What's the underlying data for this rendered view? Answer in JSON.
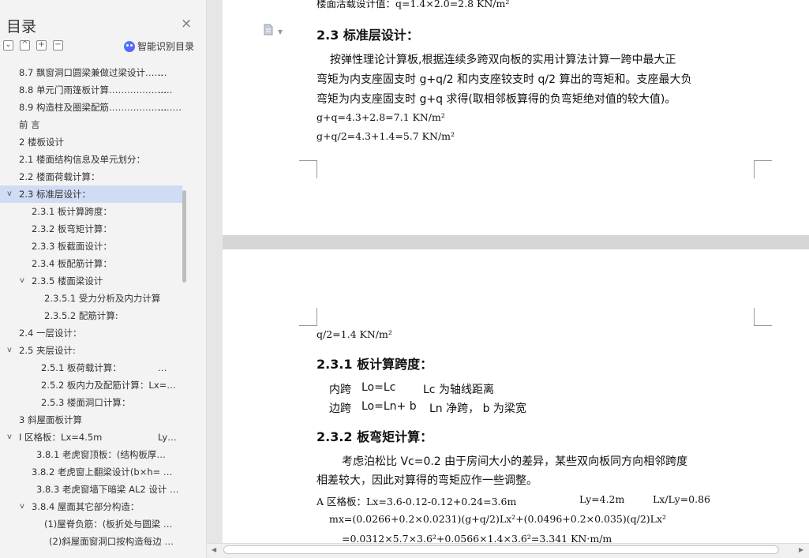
{
  "sidebar": {
    "title": "目录",
    "close_glyph": "×",
    "tools": [
      "⌄",
      "^",
      "+",
      "−"
    ],
    "ai_label": "智能识别目录",
    "items": [
      {
        "label": "8.7 飘窗洞口圆梁兼做过梁设计……",
        "suffix": "…",
        "level": 1,
        "toggle": ""
      },
      {
        "label": "8.8 单元门雨篷板计算…………………",
        "suffix": "…",
        "level": 1,
        "toggle": ""
      },
      {
        "label": "8.9 构造柱及圈梁配筋……………………",
        "suffix": "…",
        "level": 1,
        "toggle": ""
      },
      {
        "label": "前    言",
        "suffix": "",
        "level": 1,
        "toggle": ""
      },
      {
        "label": "2 楼板设计",
        "suffix": "",
        "level": 1,
        "toggle": ""
      },
      {
        "label": "2.1 楼面结构信息及单元划分：",
        "suffix": "",
        "level": 1,
        "toggle": ""
      },
      {
        "label": "2.2 楼面荷载计算：",
        "suffix": "",
        "level": 1,
        "toggle": ""
      },
      {
        "label": "2.3 标准层设计：",
        "suffix": "",
        "level": 1,
        "toggle": "v",
        "selected": true
      },
      {
        "label": "2.3.1 板计算跨度：",
        "suffix": "",
        "level": 2,
        "toggle": ""
      },
      {
        "label": "2.3.2 板弯矩计算：",
        "suffix": "",
        "level": 2,
        "toggle": ""
      },
      {
        "label": "2.3.3 板截面设计：",
        "suffix": "",
        "level": 2,
        "toggle": ""
      },
      {
        "label": "2.3.4 板配筋计算：",
        "suffix": "",
        "level": 2,
        "toggle": ""
      },
      {
        "label": "2.3.5 楼面梁设计",
        "suffix": "",
        "level": 2,
        "toggle": "v"
      },
      {
        "label": "2.3.5.1 受力分析及内力计算",
        "suffix": "",
        "level": 3,
        "toggle": ""
      },
      {
        "label": "2.3.5.2 配筋计算:",
        "suffix": "",
        "level": 3,
        "toggle": ""
      },
      {
        "label": "2.4 一层设计：",
        "suffix": "",
        "level": 1,
        "toggle": ""
      },
      {
        "label": "2.5 夹层设计:",
        "suffix": "",
        "level": 1,
        "toggle": "v"
      },
      {
        "label": "2.5.1 板荷载计算：",
        "suffix": "…",
        "level": 2.6,
        "toggle": ""
      },
      {
        "label": "2.5.2 板内力及配筋计算：Lx=…",
        "suffix": "",
        "level": 2.6,
        "toggle": ""
      },
      {
        "label": "2.5.3 楼面洞口计算：",
        "suffix": "",
        "level": 2.6,
        "toggle": ""
      },
      {
        "label": "3 斜屋面板计算",
        "suffix": "",
        "level": 1,
        "toggle": ""
      },
      {
        "label": "Ⅰ 区格板：Lx=4.5m",
        "suffix": "Ly…",
        "level": 1,
        "toggle": "v"
      },
      {
        "label": "3.8.1 老虎窗顶板：(结构板厚…",
        "suffix": "",
        "level": 2.4,
        "toggle": ""
      },
      {
        "label": "3.8.2 老虎窗上翻梁设计(b×h= …",
        "suffix": "",
        "level": 2,
        "toggle": ""
      },
      {
        "label": "3.8.3 老虎窗墙下暗梁 AL2 设计 …",
        "suffix": "",
        "level": 2.4,
        "toggle": ""
      },
      {
        "label": "3.8.4 屋面其它部分构造：",
        "suffix": "",
        "level": 2,
        "toggle": "v"
      },
      {
        "label": "(1)屋脊负筋：(板折处与圆梁 …",
        "suffix": "",
        "level": 3,
        "toggle": ""
      },
      {
        "label": "(2)斜屋面窗洞口按构造每边 …",
        "suffix": "",
        "level": 3.3,
        "toggle": ""
      }
    ]
  },
  "doc": {
    "page1": {
      "top_cut": "楼面活载设计值：q=1.4×2.0=2.8 KN/m²",
      "heading": "2.3 标准层设计：",
      "p1_l1": "按弹性理论计算板,根据连续多跨双向板的实用计算法计算一跨中最大正",
      "p1_l2": "弯矩为内支座固支时 g+q/2 和内支座铰支时 q/2 算出的弯矩和。支座最大负",
      "p1_l3": "弯矩为内支座固支时 g+q 求得(取相邻板算得的负弯矩绝对值的较大值)。",
      "f1": "g+q=4.3+2.8=7.1 KN/m²",
      "f2": "g+q/2=4.3+1.4=5.7 KN/m²"
    },
    "page2": {
      "f0": "q/2=1.4 KN/m²",
      "h1": "2.3.1 板计算跨度：",
      "l1a": "内跨",
      "l1b": "Lo=Lc",
      "l1c": "Lc 为轴线距离",
      "l2a": "边跨",
      "l2b": "Lo=Ln+ b",
      "l2c": "Ln 净跨， b 为梁宽",
      "h2": "2.3.2 板弯矩计算：",
      "p2_l1": "考虑泊松比 Vc=0.2 由于房间大小的差异，某些双向板同方向相邻跨度",
      "p2_l2": "相差较大，因此对算得的弯矩应作一些调整。",
      "a1a": "A 区格板：Lx=3.6-0.12-0.12+0.24=3.6m",
      "a1b": "Ly=4.2m",
      "a1c": "Lx/Ly=0.86",
      "a2": "mx=(0.0266+0.2×0.0231)(g+q/2)Lx²+(0.0496+0.2×0.035)(q/2)Lx²",
      "a3": "=0.0312×5.7×3.6²+0.0566×1.4×3.6²=3.341 KN·m/m"
    }
  }
}
